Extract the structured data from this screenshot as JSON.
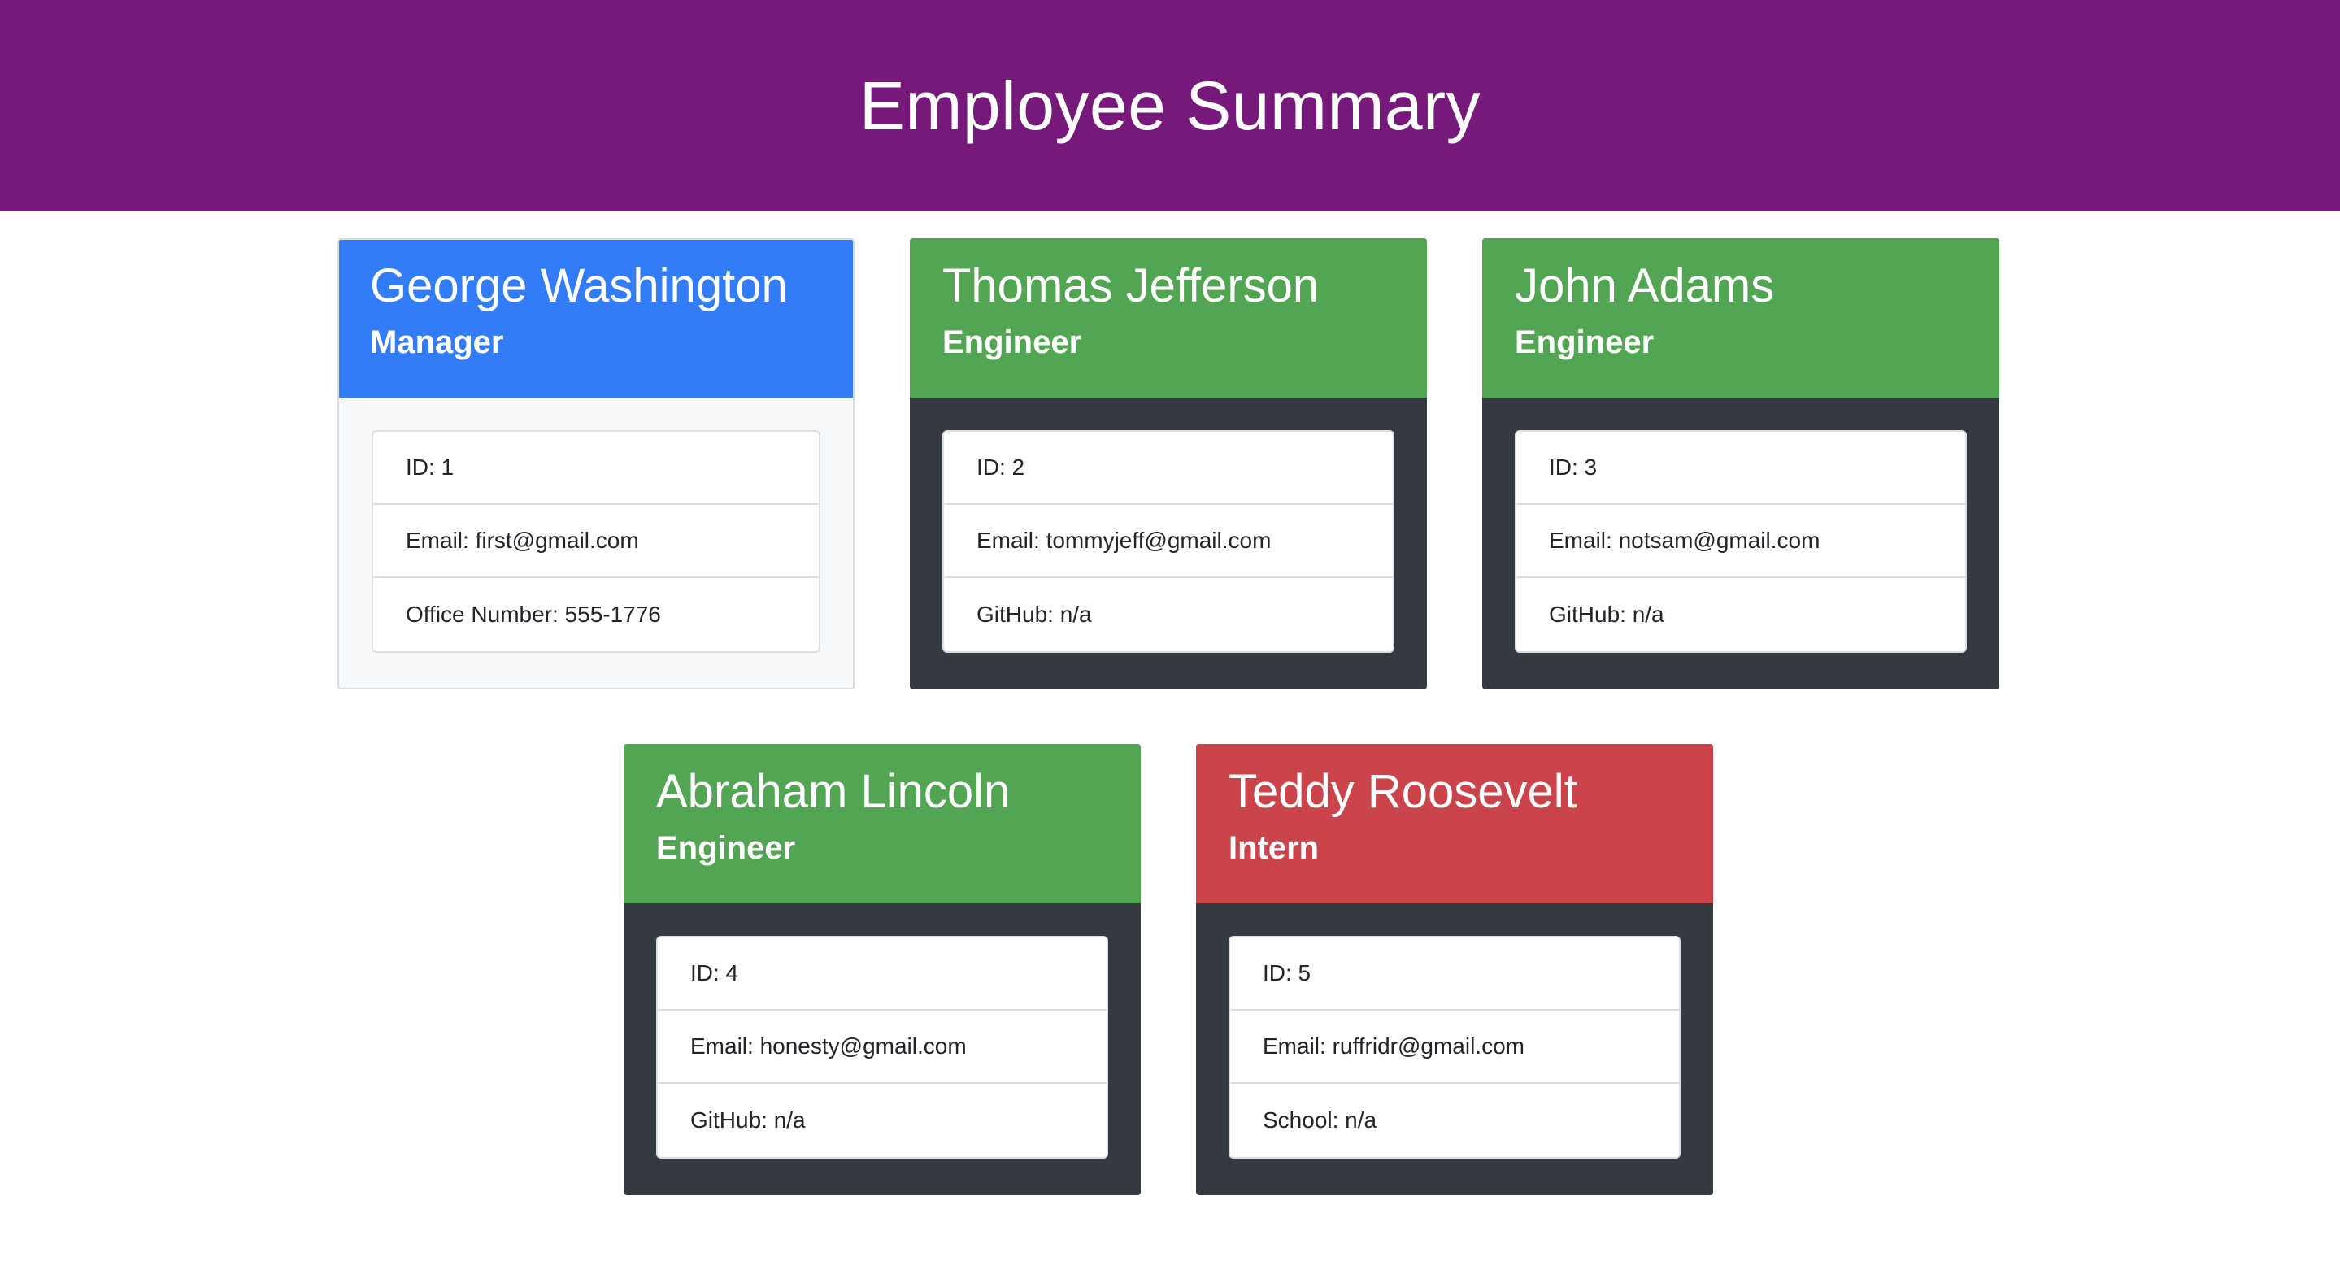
{
  "page": {
    "title": "Employee Summary"
  },
  "colors": {
    "header": "#76197b",
    "manager": "#327cf7",
    "engineer": "#52a552",
    "intern": "#cb444b",
    "dark_body": "#343a40",
    "light_body": "#f7f8f9"
  },
  "employees": [
    {
      "name": "George Washington",
      "role": "Manager",
      "id_line": "ID: 1",
      "email_line": "Email: first@gmail.com",
      "extra_line": "Office Number: 555-1776"
    },
    {
      "name": "Thomas Jefferson",
      "role": "Engineer",
      "id_line": "ID: 2",
      "email_line": "Email: tommyjeff@gmail.com",
      "extra_line": "GitHub: n/a"
    },
    {
      "name": "John Adams",
      "role": "Engineer",
      "id_line": "ID: 3",
      "email_line": "Email: notsam@gmail.com",
      "extra_line": "GitHub: n/a"
    },
    {
      "name": "Abraham Lincoln",
      "role": "Engineer",
      "id_line": "ID: 4",
      "email_line": "Email: honesty@gmail.com",
      "extra_line": "GitHub: n/a"
    },
    {
      "name": "Teddy Roosevelt",
      "role": "Intern",
      "id_line": "ID: 5",
      "email_line": "Email: ruffridr@gmail.com",
      "extra_line": "School: n/a"
    }
  ]
}
